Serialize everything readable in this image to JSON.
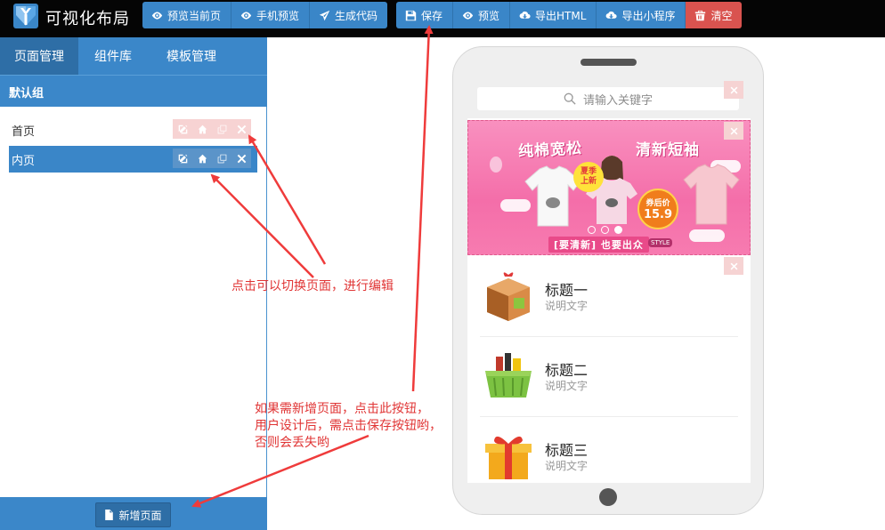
{
  "app": {
    "title": "可视化布局"
  },
  "toolbar_left": [
    {
      "label": "预览当前页",
      "icon": "eye-icon"
    },
    {
      "label": "手机预览",
      "icon": "eye-icon"
    },
    {
      "label": "生成代码",
      "icon": "send-icon"
    }
  ],
  "toolbar_right": [
    {
      "label": "保存",
      "icon": "save-icon"
    },
    {
      "label": "预览",
      "icon": "eye-icon"
    },
    {
      "label": "导出HTML",
      "icon": "cloud-download-icon"
    },
    {
      "label": "导出小程序",
      "icon": "cloud-download-icon"
    },
    {
      "label": "清空",
      "icon": "trash-icon",
      "color": "#d9534f"
    }
  ],
  "left_panel": {
    "tabs": [
      "页面管理",
      "组件库",
      "模板管理"
    ],
    "active_tab": "页面管理",
    "group_name": "默认组",
    "pages": [
      {
        "label": "首页",
        "active": false
      },
      {
        "label": "内页",
        "active": true
      }
    ],
    "add_page_label": "新增页面"
  },
  "phone": {
    "search_placeholder": "请输入关键字",
    "banner": {
      "headline_left": "纯棉宽松",
      "headline_right": "清新短袖",
      "season_line1": "夏季",
      "season_line2": "上新",
      "price_label": "券后价",
      "price": "15.9",
      "slogan": "[要清新] 也要出众",
      "style_tag": "STYLE",
      "active_dot": 3,
      "dot_count": 3
    },
    "list": [
      {
        "title": "标题一",
        "desc": "说明文字",
        "icon": "gift-box-icon"
      },
      {
        "title": "标题二",
        "desc": "说明文字",
        "icon": "shopping-basket-icon"
      },
      {
        "title": "标题三",
        "desc": "说明文字",
        "icon": "gift-icon"
      }
    ]
  },
  "annotations": {
    "switch_page": "点击可以切换页面，进行编辑",
    "add_save_line1": "如果需新增页面，点击此按钮，",
    "add_save_line2": "用户设计后，需点击保存按钮哟，",
    "add_save_line3": "否则会丢失哟"
  },
  "colors": {
    "accent": "#3a86c8",
    "danger": "#d9534f",
    "annotation": "#e03434",
    "banner_pink": "#f46ea9"
  }
}
